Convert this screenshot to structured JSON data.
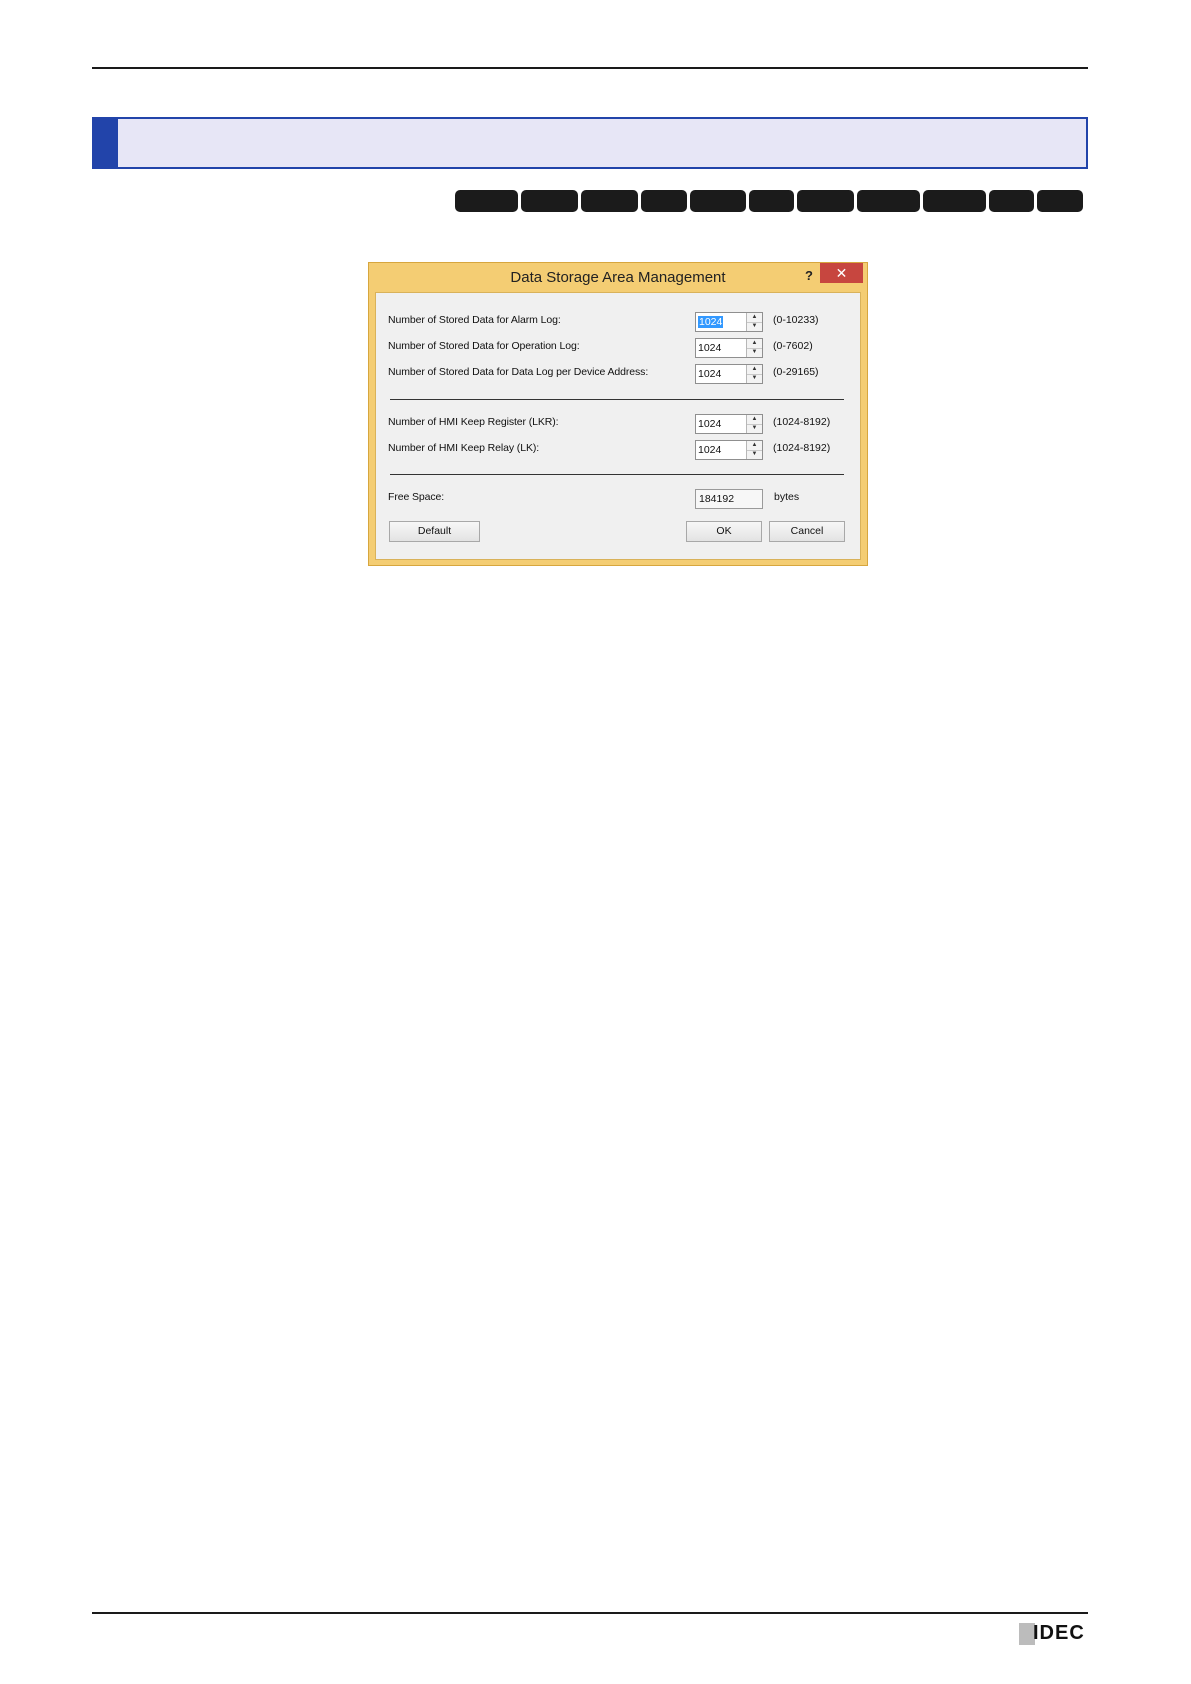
{
  "dialog": {
    "title": "Data Storage Area Management",
    "help_glyph": "?",
    "close_glyph": "✕",
    "rows": [
      {
        "label": "Number of Stored Data for Alarm Log:",
        "value": "1024",
        "range": "(0-10233)"
      },
      {
        "label": "Number of Stored Data for Operation Log:",
        "value": "1024",
        "range": "(0-7602)"
      },
      {
        "label": "Number of Stored Data for Data Log per Device Address:",
        "value": "1024",
        "range": "(0-29165)"
      },
      {
        "label": "Number of HMI Keep Register (LKR):",
        "value": "1024",
        "range": "(1024-8192)"
      },
      {
        "label": "Number of HMI Keep Relay (LK):",
        "value": "1024",
        "range": "(1024-8192)"
      }
    ],
    "free_space": {
      "label": "Free Space:",
      "value": "184192",
      "unit": "bytes"
    },
    "buttons": {
      "default": "Default",
      "ok": "OK",
      "cancel": "Cancel"
    }
  },
  "footer": {
    "logo_text": "IDEC"
  },
  "colors": {
    "header_fill": "#e7e6f6",
    "header_accent": "#2244aa",
    "dialog_frame": "#f4cd73",
    "close_button": "#c7463f"
  }
}
